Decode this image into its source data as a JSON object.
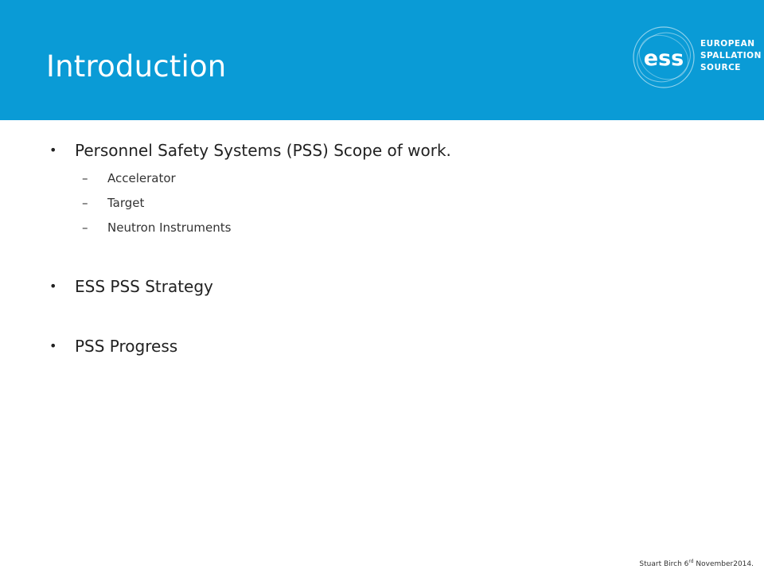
{
  "slide": {
    "title": "Introduction",
    "logo": {
      "mark": "ess",
      "lines": [
        "EUROPEAN",
        "SPALLATION",
        "SOURCE"
      ]
    },
    "bullets": [
      {
        "text": "Personnel Safety Systems (PSS) Scope of work.",
        "subitems": [
          "Accelerator",
          "Target",
          "Neutron Instruments"
        ]
      },
      {
        "text": "ESS PSS Strategy",
        "subitems": []
      },
      {
        "text": "PSS Progress",
        "subitems": []
      }
    ],
    "bullet_marker": "•",
    "sub_marker": "–",
    "footer": {
      "prefix": "Stuart Birch 6",
      "superscript": "rd",
      "suffix": " November2014."
    }
  },
  "colors": {
    "header": "#0a9bd6",
    "title": "#ffffff",
    "body_text": "#222222"
  }
}
